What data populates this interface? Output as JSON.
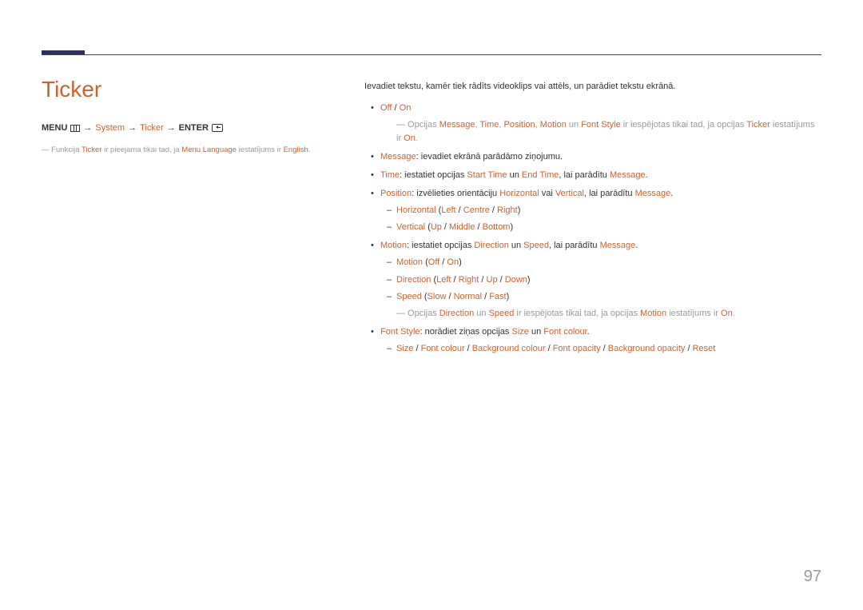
{
  "page_title": "Ticker",
  "page_number": "97",
  "breadcrumb": {
    "menu": "MENU",
    "arrow": "→",
    "system": "System",
    "ticker": "Ticker",
    "enter": "ENTER"
  },
  "left_note": {
    "prefix": "―  Funkcija ",
    "ticker": "Ticker",
    "mid": " ir pieejama tikai tad, ja ",
    "menu_lang": "Menu Language",
    "mid2": " iestatījums ir ",
    "english": "English",
    "suffix": "."
  },
  "intro": "Ievadiet tekstu, kamēr tiek rādīts videoklips vai attēls, un parādiet tekstu ekrānā.",
  "b1": {
    "off": "Off",
    "slash": " / ",
    "on": "On"
  },
  "note1": {
    "pre": "―  Opcijas ",
    "message": "Message",
    "c": ", ",
    "time": "Time",
    "position": "Position",
    "motion": "Motion",
    "un": " un ",
    "fontstyle": "Font Style",
    "mid": " ir iespējotas tikai tad, ja opcijas ",
    "ticker": "Ticker",
    "mid2": " iestatījums ir ",
    "on": "On",
    "dot": "."
  },
  "b_message": {
    "label": "Message",
    "text": ": ievadiet ekrānā parādāmo ziņojumu."
  },
  "b_time": {
    "label": "Time",
    "t1": ": iestatiet opcijas ",
    "start": "Start Time",
    "un": " un ",
    "end": "End Time",
    "t2": ", lai parādītu ",
    "message": "Message",
    "dot": "."
  },
  "b_position": {
    "label": "Position",
    "t1": ": izvēlieties orientāciju ",
    "horizontal": "Horizontal",
    "vai": " vai ",
    "vertical": "Vertical",
    "t2": ", lai parādītu ",
    "message": "Message",
    "dot": "."
  },
  "d_horiz": {
    "label": "Horizontal",
    "open": " (",
    "left": "Left",
    "s": " / ",
    "centre": "Centre",
    "right": "Right",
    "close": ")"
  },
  "d_vert": {
    "label": "Vertical",
    "open": " (",
    "up": "Up",
    "s": " / ",
    "middle": "Middle",
    "bottom": "Bottom",
    "close": ")"
  },
  "b_motion": {
    "label": "Motion",
    "t1": ": iestatiet opcijas ",
    "direction": "Direction",
    "un": " un ",
    "speed": "Speed",
    "t2": ", lai parādītu ",
    "message": "Message",
    "dot": "."
  },
  "d_motion": {
    "label": "Motion",
    "open": " (",
    "off": "Off",
    "s": " / ",
    "on": "On",
    "close": ")"
  },
  "d_dir": {
    "label": "Direction",
    "open": " (",
    "left": "Left",
    "s": " / ",
    "right": "Right",
    "up": "Up",
    "down": "Down",
    "close": ")"
  },
  "d_speed": {
    "label": "Speed",
    "open": " (",
    "slow": "Slow",
    "s": " / ",
    "normal": "Normal",
    "fast": "Fast",
    "close": ")"
  },
  "note2": {
    "pre": "―  Opcijas ",
    "direction": "Direction",
    "un": " un ",
    "speed": "Speed",
    "mid": " ir iespējotas tikai tad, ja opcijas ",
    "motion": "Motion",
    "mid2": " iestatījums ir ",
    "on": "On",
    "dot": "."
  },
  "b_font": {
    "label": "Font Style",
    "t1": ": norādiet ziņas opcijas ",
    "size": "Size",
    "un": " un ",
    "fontcolour": "Font colour",
    "dot": "."
  },
  "d_font_opts": {
    "size": "Size",
    "s": " / ",
    "fc": "Font colour",
    "bc": "Background colour",
    "fo": "Font opacity",
    "bo": "Background opacity",
    "reset": "Reset"
  }
}
